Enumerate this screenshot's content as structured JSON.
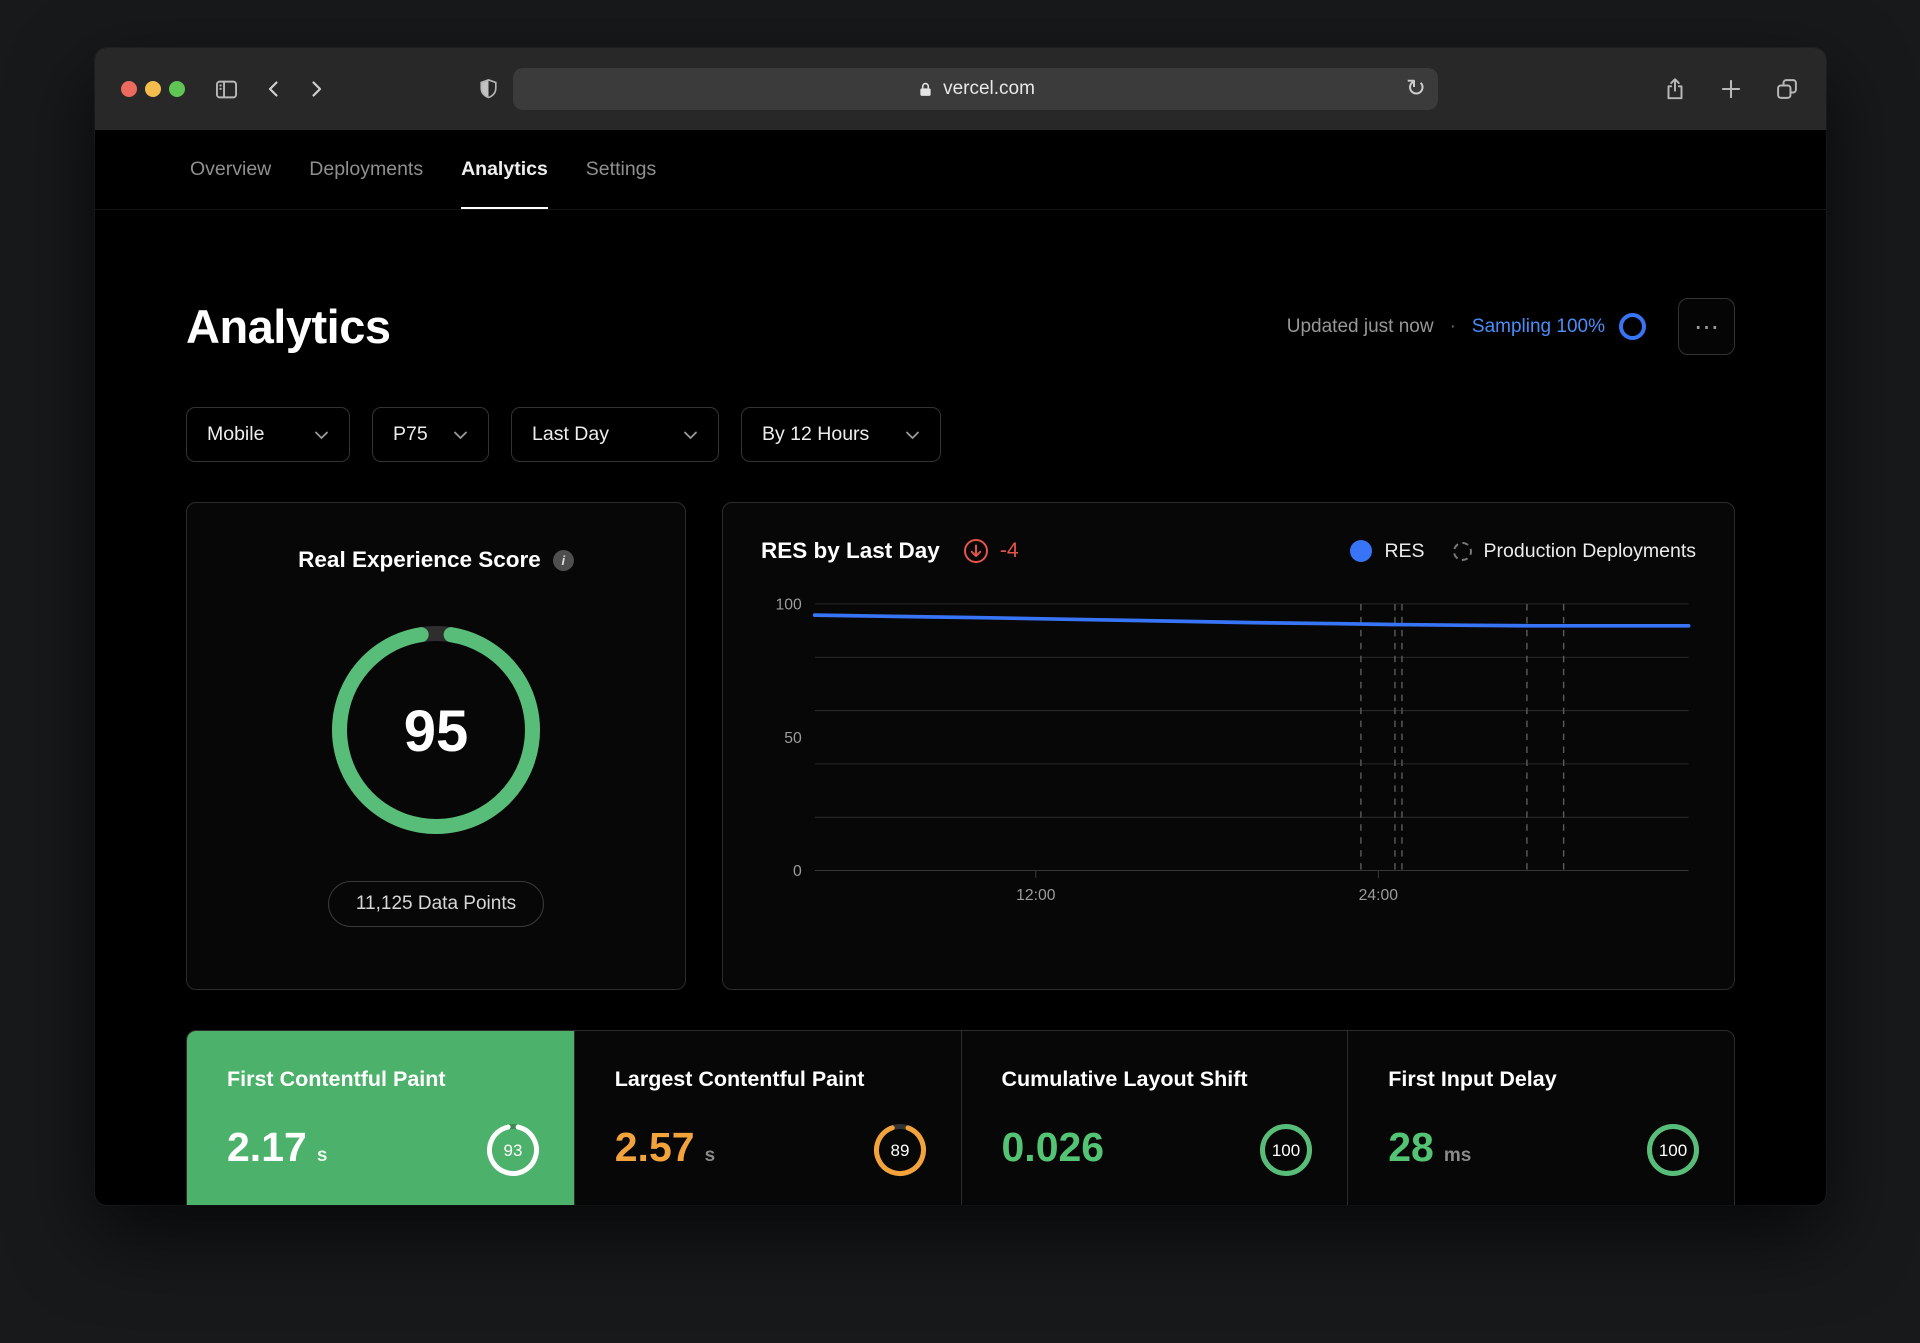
{
  "browser": {
    "url": "vercel.com",
    "traffic_lights": [
      "#ed6a5e",
      "#f4be4f",
      "#61c555"
    ]
  },
  "glyphs": {
    "reload": "↻",
    "menu": "⋯",
    "dot": "·",
    "info": "i"
  },
  "nav": {
    "tabs": [
      {
        "label": "Overview",
        "active": false
      },
      {
        "label": "Deployments",
        "active": false
      },
      {
        "label": "Analytics",
        "active": true
      },
      {
        "label": "Settings",
        "active": false
      }
    ]
  },
  "header": {
    "title": "Analytics",
    "updated": "Updated just now",
    "sampling": "Sampling 100%"
  },
  "filters": [
    {
      "label": "Mobile"
    },
    {
      "label": "P75"
    },
    {
      "label": "Last Day"
    },
    {
      "label": "By 12 Hours"
    }
  ],
  "res_card": {
    "title": "Real Experience Score",
    "score": 95,
    "ring_color": "#58bd78",
    "data_points": "11,125 Data Points"
  },
  "chart_card": {
    "title": "RES by Last Day",
    "delta": "-4",
    "legend": [
      {
        "label": "RES"
      },
      {
        "label": "Production Deployments"
      }
    ]
  },
  "chart_data": {
    "type": "line",
    "title": "RES by Last Day",
    "ylim": [
      0,
      100
    ],
    "y_ticks": [
      0,
      50,
      100
    ],
    "y_grid": [
      0,
      20,
      40,
      60,
      80,
      100
    ],
    "grid": true,
    "legend_position": "top-right",
    "x_ticks": [
      {
        "frac": 0.253,
        "label": "12:00"
      },
      {
        "frac": 0.645,
        "label": "24:00"
      }
    ],
    "series": [
      {
        "name": "RES",
        "color": "#3875f6",
        "points": [
          [
            0,
            95.8
          ],
          [
            0.1,
            95.3
          ],
          [
            0.2,
            94.8
          ],
          [
            0.3,
            94.2
          ],
          [
            0.4,
            93.6
          ],
          [
            0.5,
            93.0
          ],
          [
            0.6,
            92.6
          ],
          [
            0.66,
            92.3
          ],
          [
            0.75,
            92.0
          ],
          [
            0.82,
            91.8
          ],
          [
            0.9,
            91.8
          ],
          [
            1,
            91.8
          ]
        ]
      }
    ],
    "deployments": {
      "name": "Production Deployments",
      "fracs": [
        0.625,
        0.664,
        0.672,
        0.815,
        0.857
      ]
    }
  },
  "metrics": [
    {
      "title": "First Contentful Paint",
      "value": "2.17",
      "unit": "s",
      "score": 93,
      "highlight": true,
      "ring_color": "#ffffff"
    },
    {
      "title": "Largest Contentful Paint",
      "value": "2.57",
      "unit": "s",
      "score": 89,
      "color": "#f2a33c",
      "ring_color": "#f2a33c"
    },
    {
      "title": "Cumulative Layout Shift",
      "value": "0.026",
      "unit": "",
      "score": 100,
      "color": "#53c474",
      "ring_color": "#58bd78"
    },
    {
      "title": "First Input Delay",
      "value": "28",
      "unit": "ms",
      "score": 100,
      "color": "#53c474",
      "ring_color": "#58bd78"
    }
  ],
  "colors": {
    "background": "#17191b",
    "chrome": "#282828",
    "content": "#000000",
    "green_card": "#4cb16a",
    "gauge_green": "#58bd78",
    "value_green": "#53c474",
    "blue": "#3875f6",
    "link_blue": "#4b8df8",
    "orange": "#f2a33c",
    "red": "#e5544b",
    "border": "#2c2c2c"
  }
}
